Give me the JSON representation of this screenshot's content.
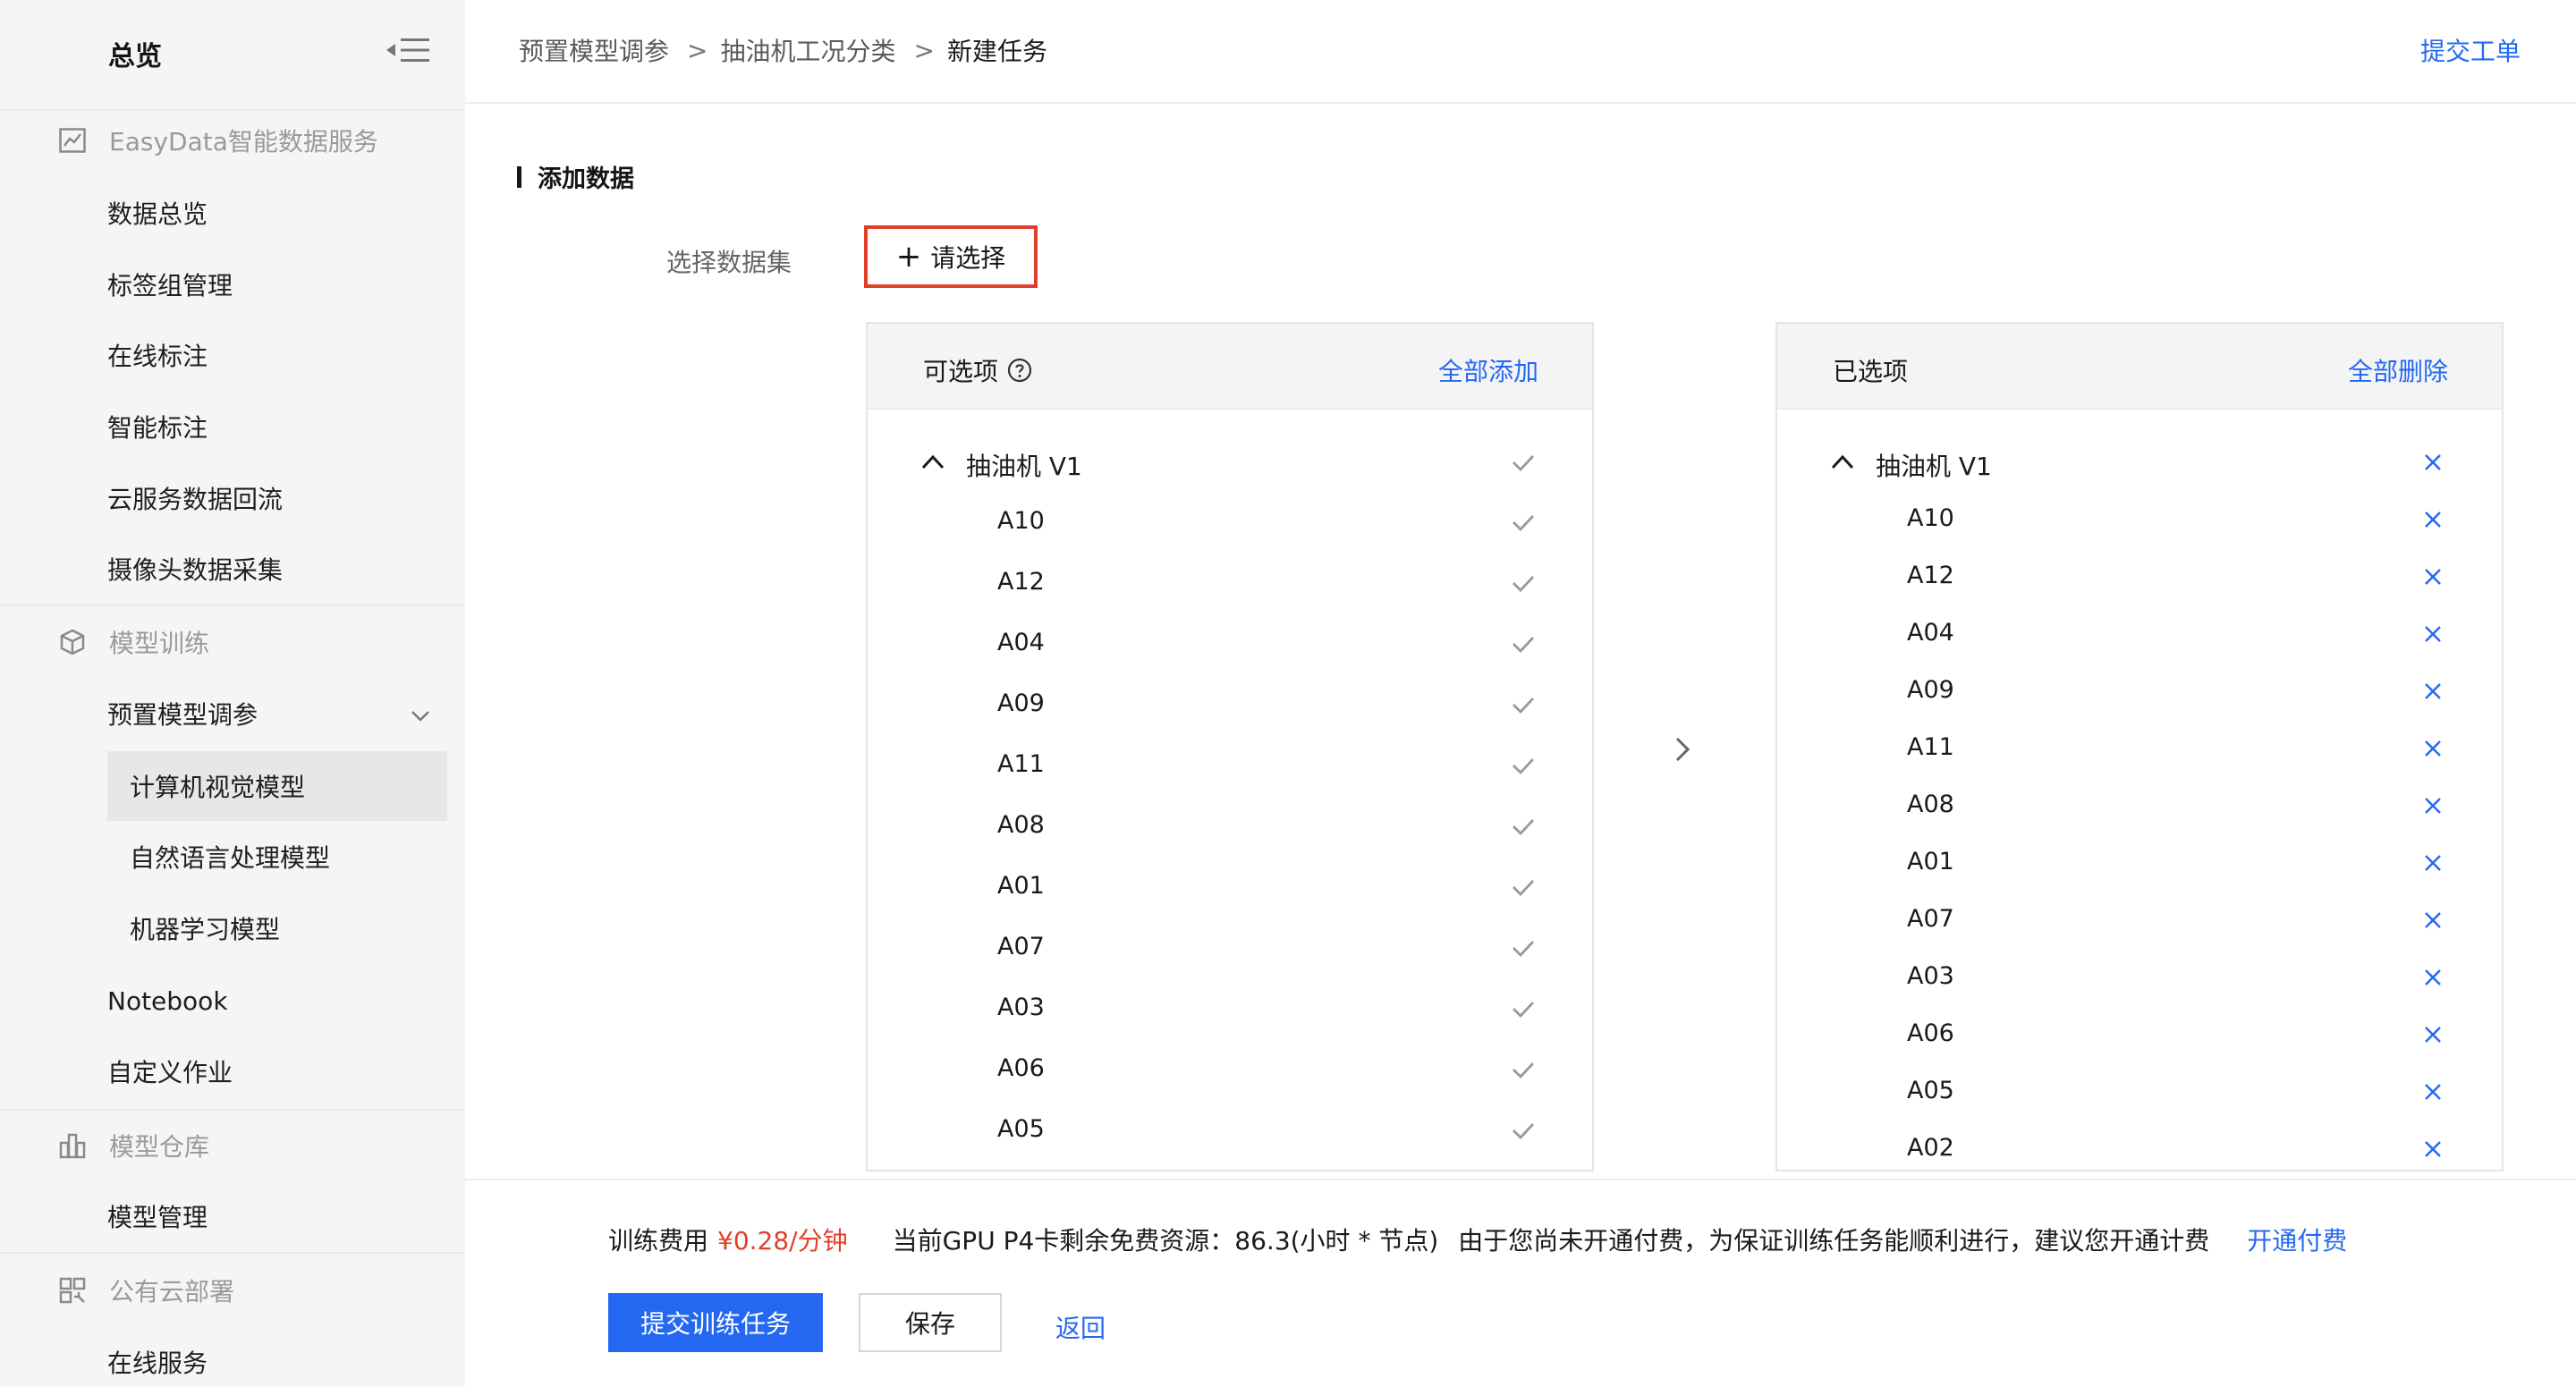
{
  "sidebar": {
    "title": "总览",
    "groups": [
      {
        "icon": "chart-icon",
        "label": "EasyData智能数据服务",
        "items": [
          "数据总览",
          "标签组管理",
          "在线标注",
          "智能标注",
          "云服务数据回流",
          "摄像头数据采集"
        ]
      },
      {
        "icon": "cube-icon",
        "label": "模型训练",
        "expanded_item": "预置模型调参",
        "sub_items": [
          "计算机视觉模型",
          "自然语言处理模型",
          "机器学习模型"
        ],
        "active_sub_item": "计算机视觉模型",
        "items": [
          "Notebook",
          "自定义作业"
        ]
      },
      {
        "icon": "warehouse-icon",
        "label": "模型仓库",
        "items": [
          "模型管理"
        ]
      },
      {
        "icon": "deploy-icon",
        "label": "公有云部署",
        "items": [
          "在线服务"
        ]
      }
    ]
  },
  "header": {
    "breadcrumb": [
      "预置模型调参",
      "抽油机工况分类",
      "新建任务"
    ],
    "action": "提交工单"
  },
  "form": {
    "section_title": "添加数据",
    "dataset_label": "选择数据集",
    "select_button": "请选择"
  },
  "transfer": {
    "left": {
      "title": "可选项",
      "action": "全部添加",
      "group": "抽油机 V1",
      "items": [
        "A10",
        "A12",
        "A04",
        "A09",
        "A11",
        "A08",
        "A01",
        "A07",
        "A03",
        "A06",
        "A05"
      ]
    },
    "right": {
      "title": "已选项",
      "action": "全部删除",
      "group": "抽油机 V1",
      "items": [
        "A10",
        "A12",
        "A04",
        "A09",
        "A11",
        "A08",
        "A01",
        "A07",
        "A03",
        "A06",
        "A05",
        "A02"
      ]
    }
  },
  "footer": {
    "cost_label": "训练费用",
    "cost_value": "¥0.28/分钟",
    "gpu_info": "当前GPU P4卡剩余免费资源：86.3(小时 * 节点)",
    "notice": "由于您尚未开通付费，为保证训练任务能顺利进行，建议您开通计费",
    "open_pay": "开通付费",
    "submit_button": "提交训练任务",
    "save_button": "保存",
    "back_link": "返回"
  },
  "colors": {
    "primary": "#2468f2",
    "highlight_border": "#e0402a",
    "price": "#e0402a",
    "sidebar_bg": "#f5f5f5",
    "active_item_bg": "#e7e7e7"
  }
}
